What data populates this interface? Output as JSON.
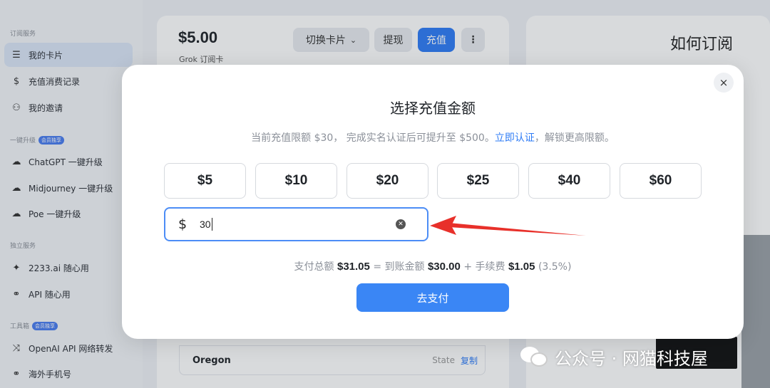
{
  "sidebar": {
    "sections": [
      {
        "title": "订阅服务"
      },
      {
        "title": "一键升级",
        "badge": "会员独享"
      },
      {
        "title": "独立服务"
      },
      {
        "title": "工具箱",
        "badge": "会员独享"
      }
    ],
    "items": [
      {
        "label": "我的卡片",
        "icon": "stack-icon",
        "active": true
      },
      {
        "label": "充值消费记录",
        "icon": "dollar-icon"
      },
      {
        "label": "我的邀请",
        "icon": "users-icon"
      },
      {
        "label": "ChatGPT 一键升级",
        "icon": "cloud-upload-icon"
      },
      {
        "label": "Midjourney 一键升级",
        "icon": "cloud-upload-icon"
      },
      {
        "label": "Poe 一键升级",
        "icon": "cloud-upload-icon"
      },
      {
        "label": "2233.ai 随心用",
        "icon": "sparkle-icon"
      },
      {
        "label": "API 随心用",
        "icon": "link-icon"
      },
      {
        "label": "OpenAI API 网络转发",
        "icon": "shuffle-icon"
      },
      {
        "label": "海外手机号",
        "icon": "link-icon"
      }
    ]
  },
  "card": {
    "amount": "$5.00",
    "subtitle": "Grok 订阅卡",
    "switch_label": "切换卡片",
    "withdraw_label": "提现",
    "recharge_label": "充值",
    "more_icon": "more-vertical-icon",
    "address_row": {
      "city": "Oregon",
      "state": "State",
      "copy": "复制"
    }
  },
  "right_panel": {
    "title": "如何订阅"
  },
  "modal": {
    "title": "选择充值金额",
    "note_prefix": "当前充值限额 $30， 完成实名认证后可提升至 $500。",
    "note_link": "立即认证",
    "note_suffix": "，解锁更高限额。",
    "presets": [
      "$5",
      "$10",
      "$20",
      "$25",
      "$40",
      "$60"
    ],
    "input": {
      "currency": "$",
      "value": "30"
    },
    "summary": {
      "total_label": "支付总额",
      "total": "$31.05",
      "eq": "=",
      "arrive_label": "到账金额",
      "arrive": "$30.00",
      "plus": "+",
      "fee_label": "手续费",
      "fee": "$1.05",
      "fee_rate": "(3.5%)"
    },
    "pay_label": "去支付",
    "close": "×"
  },
  "watermark": {
    "text": "公众号 · 网猫科技屋"
  },
  "colors": {
    "accent": "#2f7cf6",
    "arrow": "#e8302a"
  }
}
